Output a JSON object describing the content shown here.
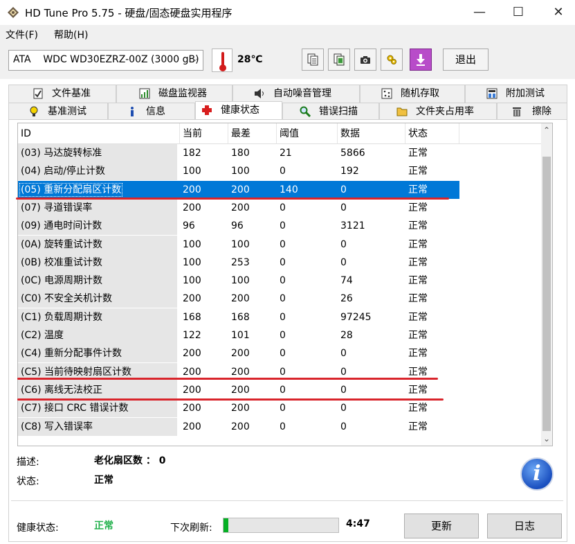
{
  "window": {
    "title": "HD Tune Pro 5.75 - 硬盘/固态硬盘实用程序",
    "min": "—",
    "max": "☐",
    "close": "✕"
  },
  "menu": {
    "file": "文件(F)",
    "help": "帮助(H)"
  },
  "toolbar": {
    "drive": "ATA    WDC WD30EZRZ-00Z (3000 gB)",
    "temperature": "28℃",
    "exit_label": "退出",
    "icons": [
      "copy-info-icon",
      "copy-all-icon",
      "screenshot-camera-icon",
      "options-wrench-icon",
      "save-down-arrow-icon"
    ]
  },
  "tabs": {
    "row1": [
      "文件基准",
      "磁盘监视器",
      "自动噪音管理",
      "随机存取",
      "附加测试"
    ],
    "row2": [
      "基准测试",
      "信息",
      "健康状态",
      "错误扫描",
      "文件夹占用率",
      "擦除"
    ]
  },
  "table": {
    "headers": [
      "ID",
      "当前",
      "最差",
      "阈值",
      "数据",
      "状态"
    ],
    "rows": [
      [
        "(03) 马达旋转标准",
        "182",
        "180",
        "21",
        "5866",
        "正常"
      ],
      [
        "(04) 启动/停止计数",
        "100",
        "100",
        "0",
        "192",
        "正常"
      ],
      [
        "(05) 重新分配扇区计数",
        "200",
        "200",
        "140",
        "0",
        "正常"
      ],
      [
        "(07) 寻道错误率",
        "200",
        "200",
        "0",
        "0",
        "正常"
      ],
      [
        "(09) 通电时间计数",
        "96",
        "96",
        "0",
        "3121",
        "正常"
      ],
      [
        "(0A) 旋转重试计数",
        "100",
        "100",
        "0",
        "0",
        "正常"
      ],
      [
        "(0B) 校准重试计数",
        "100",
        "253",
        "0",
        "0",
        "正常"
      ],
      [
        "(0C) 电源周期计数",
        "100",
        "100",
        "0",
        "74",
        "正常"
      ],
      [
        "(C0) 不安全关机计数",
        "200",
        "200",
        "0",
        "26",
        "正常"
      ],
      [
        "(C1) 负载周期计数",
        "168",
        "168",
        "0",
        "97245",
        "正常"
      ],
      [
        "(C2) 温度",
        "122",
        "101",
        "0",
        "28",
        "正常"
      ],
      [
        "(C4) 重新分配事件计数",
        "200",
        "200",
        "0",
        "0",
        "正常"
      ],
      [
        "(C5) 当前待映射扇区计数",
        "200",
        "200",
        "0",
        "0",
        "正常"
      ],
      [
        "(C6) 离线无法校正",
        "200",
        "200",
        "0",
        "0",
        "正常"
      ],
      [
        "(C7) 接口 CRC 错误计数",
        "200",
        "200",
        "0",
        "0",
        "正常"
      ],
      [
        "(C8) 写入错误率",
        "200",
        "200",
        "0",
        "0",
        "正常"
      ]
    ],
    "selected_row": 2,
    "scroll_up": "⌃",
    "scroll_down": "⌄"
  },
  "details": {
    "desc_label": "描述:",
    "desc_value": "老化扇区数 ： 0",
    "status_label": "状态:",
    "status_value": "正常"
  },
  "footer": {
    "health_label": "健康状态:",
    "health_value": "正常",
    "refresh_label": "下次刷新:",
    "countdown": "4:47",
    "refresh_progress": 0.04,
    "update_label": "更新",
    "log_label": "日志"
  },
  "colors": {
    "selection": "#0078d7",
    "highlight_line": "#d9242b",
    "health_ok": "#22b14c",
    "progress": "#06b025"
  }
}
